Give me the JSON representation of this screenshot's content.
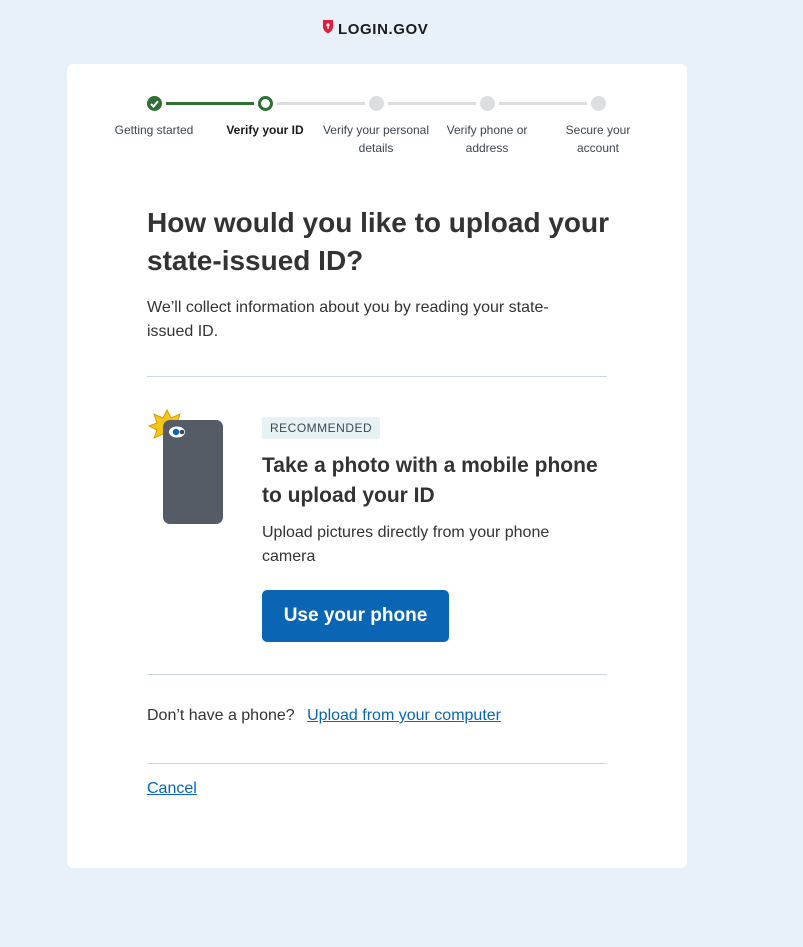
{
  "header": {
    "logo_text": "LOGIN.GOV",
    "logo_icon": "shield-lock-icon",
    "logo_color": "#e21c3d"
  },
  "steps": [
    {
      "label": "Getting started",
      "status": "complete"
    },
    {
      "label": "Verify your ID",
      "status": "current"
    },
    {
      "label": "Verify your personal details",
      "status": "incomplete"
    },
    {
      "label": "Verify phone or address",
      "status": "incomplete"
    },
    {
      "label": "Secure your account",
      "status": "incomplete"
    }
  ],
  "main": {
    "heading": "How would you like to upload your state-issued ID?",
    "intro": "We’ll collect information about you by reading your state-issued ID.",
    "option": {
      "badge": "RECOMMENDED",
      "title": "Take a photo with a mobile phone to upload your ID",
      "description": "Upload pictures directly from your phone camera",
      "button_label": "Use your phone",
      "illustration_icon": "phone-camera-icon"
    },
    "alternative": {
      "prompt": "Don’t have a phone?",
      "link_label": "Upload from your computer"
    },
    "cancel_label": "Cancel"
  },
  "colors": {
    "accent": "#0a65b4",
    "success": "#2e6f34",
    "background": "#e8f0fa"
  }
}
